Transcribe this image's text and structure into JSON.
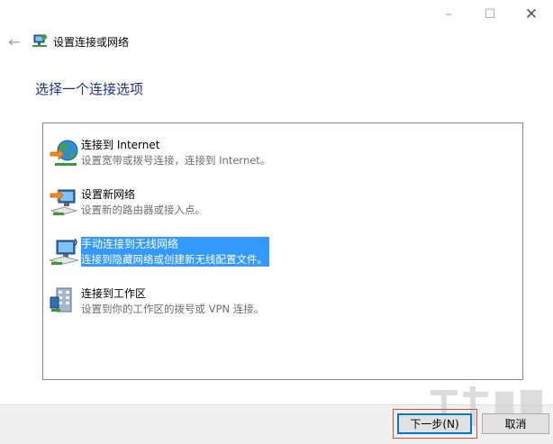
{
  "window": {
    "title": "设置连接或网络",
    "controls": {
      "minimize": "–",
      "maximize": "☐",
      "close": "✕"
    },
    "back_glyph": "←"
  },
  "heading": "选择一个连接选项",
  "options": [
    {
      "title": "连接到 Internet",
      "desc": "设置宽带或拨号连接，连接到 Internet。",
      "icon": "internet-globe-icon",
      "selected": false
    },
    {
      "title": "设置新网络",
      "desc": "设置新的路由器或接入点。",
      "icon": "network-setup-icon",
      "selected": false
    },
    {
      "title": "手动连接到无线网络",
      "desc": "连接到隐藏网络或创建新无线配置文件。",
      "icon": "wireless-network-icon",
      "selected": true
    },
    {
      "title": "连接到工作区",
      "desc": "设置到你的工作区的拨号或 VPN 连接。",
      "icon": "workplace-icon",
      "selected": false
    }
  ],
  "buttons": {
    "next": "下一步(N)",
    "cancel": "取消"
  },
  "colors": {
    "heading": "#1e3287",
    "selection": "#3399ff",
    "footer": "#f0f0f0",
    "accent_border": "#0078d7"
  }
}
